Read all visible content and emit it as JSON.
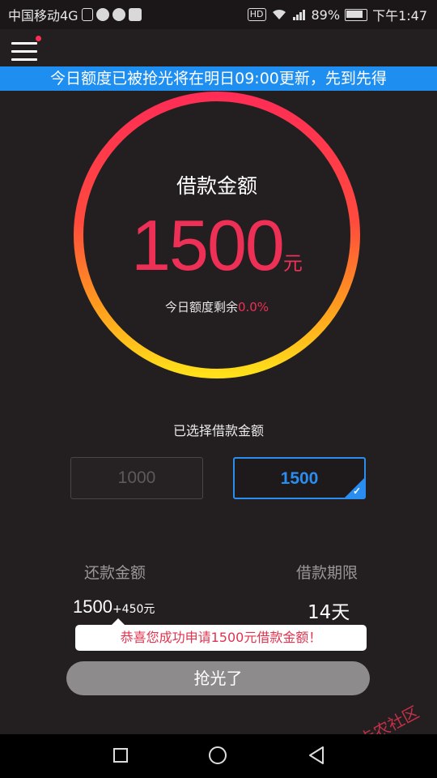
{
  "status_bar": {
    "carrier": "中国移动4G",
    "hd": "HD",
    "battery": "89%",
    "time": "下午1:47"
  },
  "banner": {
    "text": "今日额度已被抢光将在明日09:00更新，先到先得"
  },
  "loan": {
    "title": "借款金额",
    "amount": "1500",
    "unit": "元",
    "remaining_label": "今日额度剩余",
    "remaining_percent": "0.0%"
  },
  "selection": {
    "label": "已选择借款金额",
    "options": [
      "1000",
      "1500"
    ],
    "selected": "1500"
  },
  "repayment": {
    "repay_label": "还款金额",
    "term_label": "借款期限",
    "repay_amount": "1500",
    "repay_extra": "+450元",
    "term_value": "14天"
  },
  "toast": {
    "text": "恭喜您成功申请1500元借款金额！"
  },
  "action": {
    "label": "抢光了"
  },
  "watermark": {
    "text": "卡农社区"
  },
  "colors": {
    "accent_red": "#ee2f56",
    "accent_blue": "#2a8df0",
    "banner_blue": "#1f8ef1",
    "ring_gradient": [
      "#ff2d55",
      "#ffe01a"
    ]
  },
  "icons": [
    "lock-icon",
    "contacts-icon",
    "mute-icon",
    "app-icon",
    "wifi-icon",
    "signal-icon",
    "battery-icon",
    "menu-icon",
    "check-icon",
    "nav-recent-icon",
    "nav-home-icon",
    "nav-back-icon"
  ]
}
